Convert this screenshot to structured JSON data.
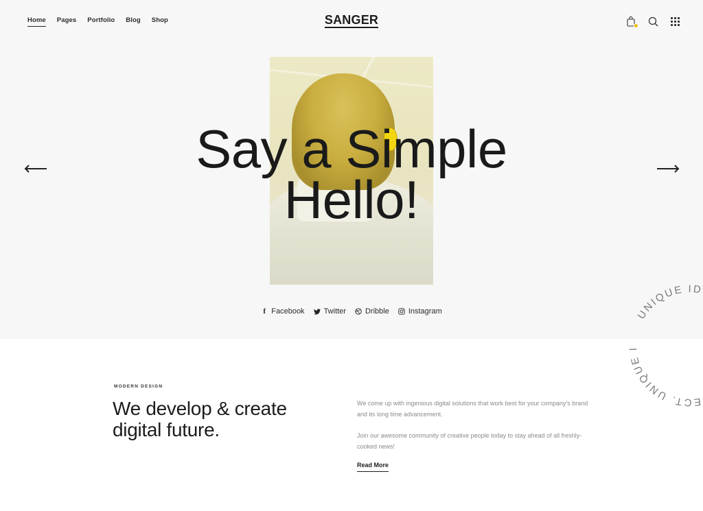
{
  "header": {
    "logo": "SANGER",
    "nav": [
      {
        "label": "Home",
        "active": true
      },
      {
        "label": "Pages",
        "active": false
      },
      {
        "label": "Portfolio",
        "active": false
      },
      {
        "label": "Blog",
        "active": false
      },
      {
        "label": "Shop",
        "active": false
      }
    ],
    "icons": [
      "shopping-bag-icon",
      "search-icon",
      "grid-menu-icon"
    ],
    "cart_badge_color": "#f2c000"
  },
  "hero": {
    "title_line1": "Say a Simple",
    "title_line2": "Hello!",
    "prev_icon": "arrow-left-icon",
    "next_icon": "arrow-right-icon",
    "social": [
      {
        "icon": "facebook-icon",
        "glyph": "f",
        "label": "Facebook"
      },
      {
        "icon": "twitter-icon",
        "glyph": "🐦",
        "label": "Twitter"
      },
      {
        "icon": "dribbble-icon",
        "glyph": "◎",
        "label": "Dribble"
      },
      {
        "icon": "instagram-icon",
        "glyph": "◻",
        "label": "Instagram"
      }
    ],
    "circle_text": "UNIQUE IDEAS FOR EVERY PROJECT. UNIQUE IDEAS FOR EVERY PROJECT."
  },
  "about": {
    "eyebrow": "MODERN DESIGN",
    "headline_line1": "We develop & create",
    "headline_line2": "digital future.",
    "paragraph1": "We come up with ingenious digital solutions that work best for your company's brand and its long time advancement.",
    "paragraph2": "Join our awesome community of creative people today to stay ahead of all freshly-cooked news!",
    "read_more": "Read More"
  },
  "colors": {
    "hero_bg": "#f7f7f7",
    "text": "#1c1c1c",
    "accent": "#f2c000"
  }
}
